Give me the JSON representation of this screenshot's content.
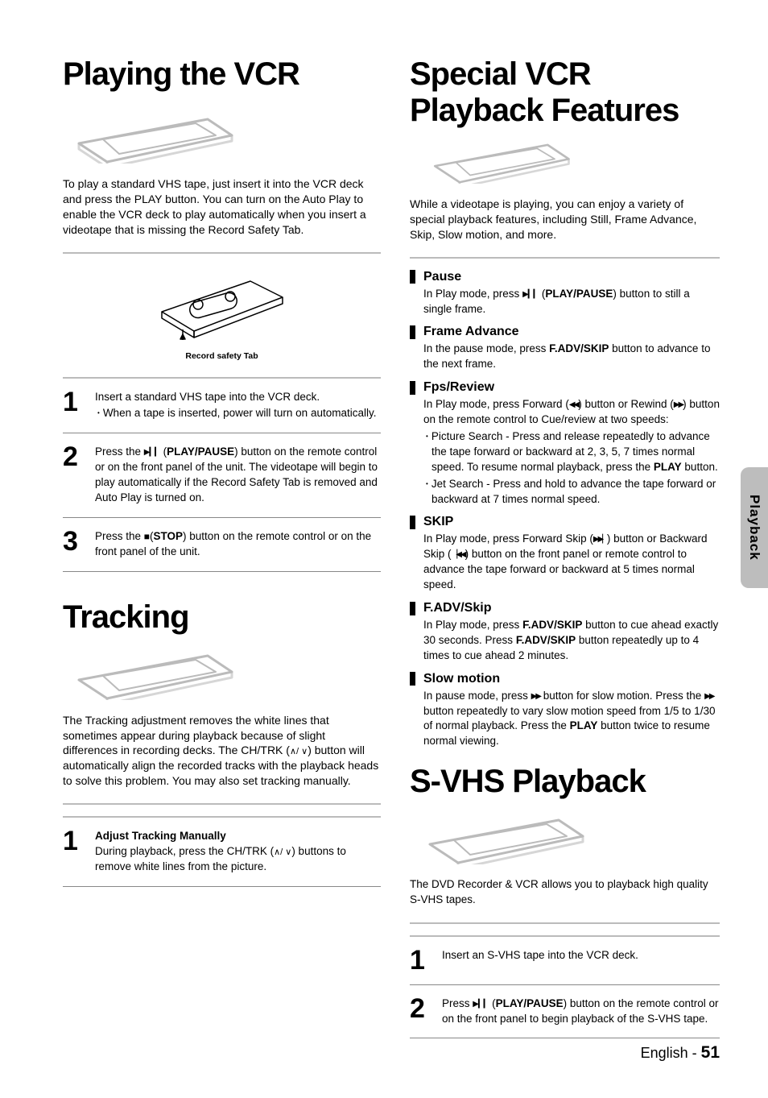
{
  "side_tab": "Playback",
  "footer": {
    "lang": "English",
    "sep": "-",
    "page": "51"
  },
  "left": {
    "h1": "Playing the VCR",
    "intro_parts": [
      "To play a standard VHS tape, just insert it into the VCR deck and press the ",
      "PLAY",
      " button. You can turn on the Auto Play to enable the VCR deck to play automatically when you insert a videotape that is missing the Record Safety Tab."
    ],
    "record_label": "Record safety Tab",
    "steps": [
      {
        "num": "1",
        "lines": [
          {
            "t": "Insert a standard VHS tape into the VCR deck."
          },
          {
            "t": "When a tape is inserted, power will turn on automatically.",
            "bullet": true
          }
        ]
      },
      {
        "num": "2",
        "lines": [
          {
            "rich": [
              "Press the  ",
              {
                "sym": "play-pause"
              },
              " (",
              {
                "b": "PLAY/PAUSE"
              },
              ") button on the remote control or on the front panel of the unit. The videotape will begin to play automatically if the Record Safety Tab is removed and Auto Play is turned on."
            ]
          }
        ]
      },
      {
        "num": "3",
        "lines": [
          {
            "rich": [
              "Press the ",
              {
                "sym": "stop-sq"
              },
              "(",
              {
                "b": "STOP"
              },
              ") button on the remote control or on the front panel of the unit."
            ]
          }
        ]
      }
    ],
    "h2": "Tracking",
    "tracking_parts": [
      "The Tracking adjustment removes the white lines that sometimes appear during playback because of slight differences in recording decks. The ",
      "CH/TRK",
      " (",
      {
        "sym": "updown"
      },
      ") button will automatically align the recorded tracks with the playback heads to solve this problem. You may also set tracking manually."
    ],
    "tracking_step": {
      "num": "1",
      "title": "Adjust Tracking Manually",
      "body_parts": [
        "During playback, press the ",
        "CH/TRK",
        " (",
        {
          "sym": "updown"
        },
        ") buttons to remove white lines from the picture."
      ]
    }
  },
  "right": {
    "h1": "Special VCR Playback Features",
    "intro": "While a videotape is playing, you can enjoy a variety of special playback features, including Still, Frame Advance, Skip, Slow motion, and more.",
    "features": [
      {
        "title": "Pause",
        "body": [
          [
            "In Play mode, press ",
            {
              "sym": "play-pause"
            },
            " (",
            {
              "b": "PLAY/PAUSE"
            },
            ") button to still a single frame."
          ]
        ]
      },
      {
        "title": "Frame Advance",
        "body": [
          [
            "In the pause mode, press ",
            {
              "b": "F.ADV/SKIP"
            },
            " button to advance to the next frame."
          ]
        ]
      },
      {
        "title": "Fps/Review",
        "body": [
          [
            "In Play mode, press Forward (",
            {
              "sym": "tri-ll"
            },
            ") button or Rewind (",
            {
              "sym": "tri-rr"
            },
            ") button on the remote control to Cue/review at two speeds:"
          ],
          {
            "bullet": true,
            "rich": [
              "Picture Search - Press and release repeatedly to advance the tape forward or backward at 2, 3, 5, 7 times normal speed. To resume normal playback, press the ",
              {
                "b": "PLAY"
              },
              " button."
            ]
          },
          {
            "bullet": true,
            "rich": [
              "Jet Search - Press and hold to advance the tape forward or backward at 7 times normal speed."
            ]
          }
        ]
      },
      {
        "title": "SKIP",
        "body": [
          [
            "In Play mode, press Forward Skip (",
            {
              "sym": "tri-rbar"
            },
            ") button or Backward Skip (",
            {
              "sym": "bar-tri-l"
            },
            ") button on the front panel or remote control to advance the tape forward or backward at 5 times normal speed."
          ]
        ]
      },
      {
        "title": "F.ADV/Skip",
        "body": [
          [
            "In Play mode, press ",
            {
              "b": "F.ADV/SKIP"
            },
            " button to cue ahead exactly 30 seconds. Press ",
            {
              "b": "F.ADV/SKIP"
            },
            " button repeatedly up to 4 times to cue ahead 2 minutes."
          ]
        ]
      },
      {
        "title": "Slow motion",
        "body": [
          [
            "In pause mode, press ",
            {
              "sym": "tri-rr"
            },
            " button for slow motion. Press the ",
            {
              "sym": "tri-rr"
            },
            " button repeatedly to vary slow motion speed from 1/5 to 1/30 of normal playback. Press the ",
            {
              "b": "PLAY"
            },
            " button twice to resume normal viewing."
          ]
        ]
      }
    ],
    "h2": "S-VHS Playback",
    "svhs_intro": "The DVD Recorder & VCR allows you to playback high quality S-VHS tapes.",
    "svhs_steps": [
      {
        "num": "1",
        "lines": [
          {
            "t": "Insert an S-VHS tape into the VCR deck."
          }
        ]
      },
      {
        "num": "2",
        "lines": [
          {
            "rich": [
              "Press ",
              {
                "sym": "play-pause"
              },
              " (",
              {
                "b": "PLAY/PAUSE"
              },
              ") button on the remote control or on the front panel to begin playback of the S-VHS tape."
            ]
          }
        ]
      }
    ]
  }
}
